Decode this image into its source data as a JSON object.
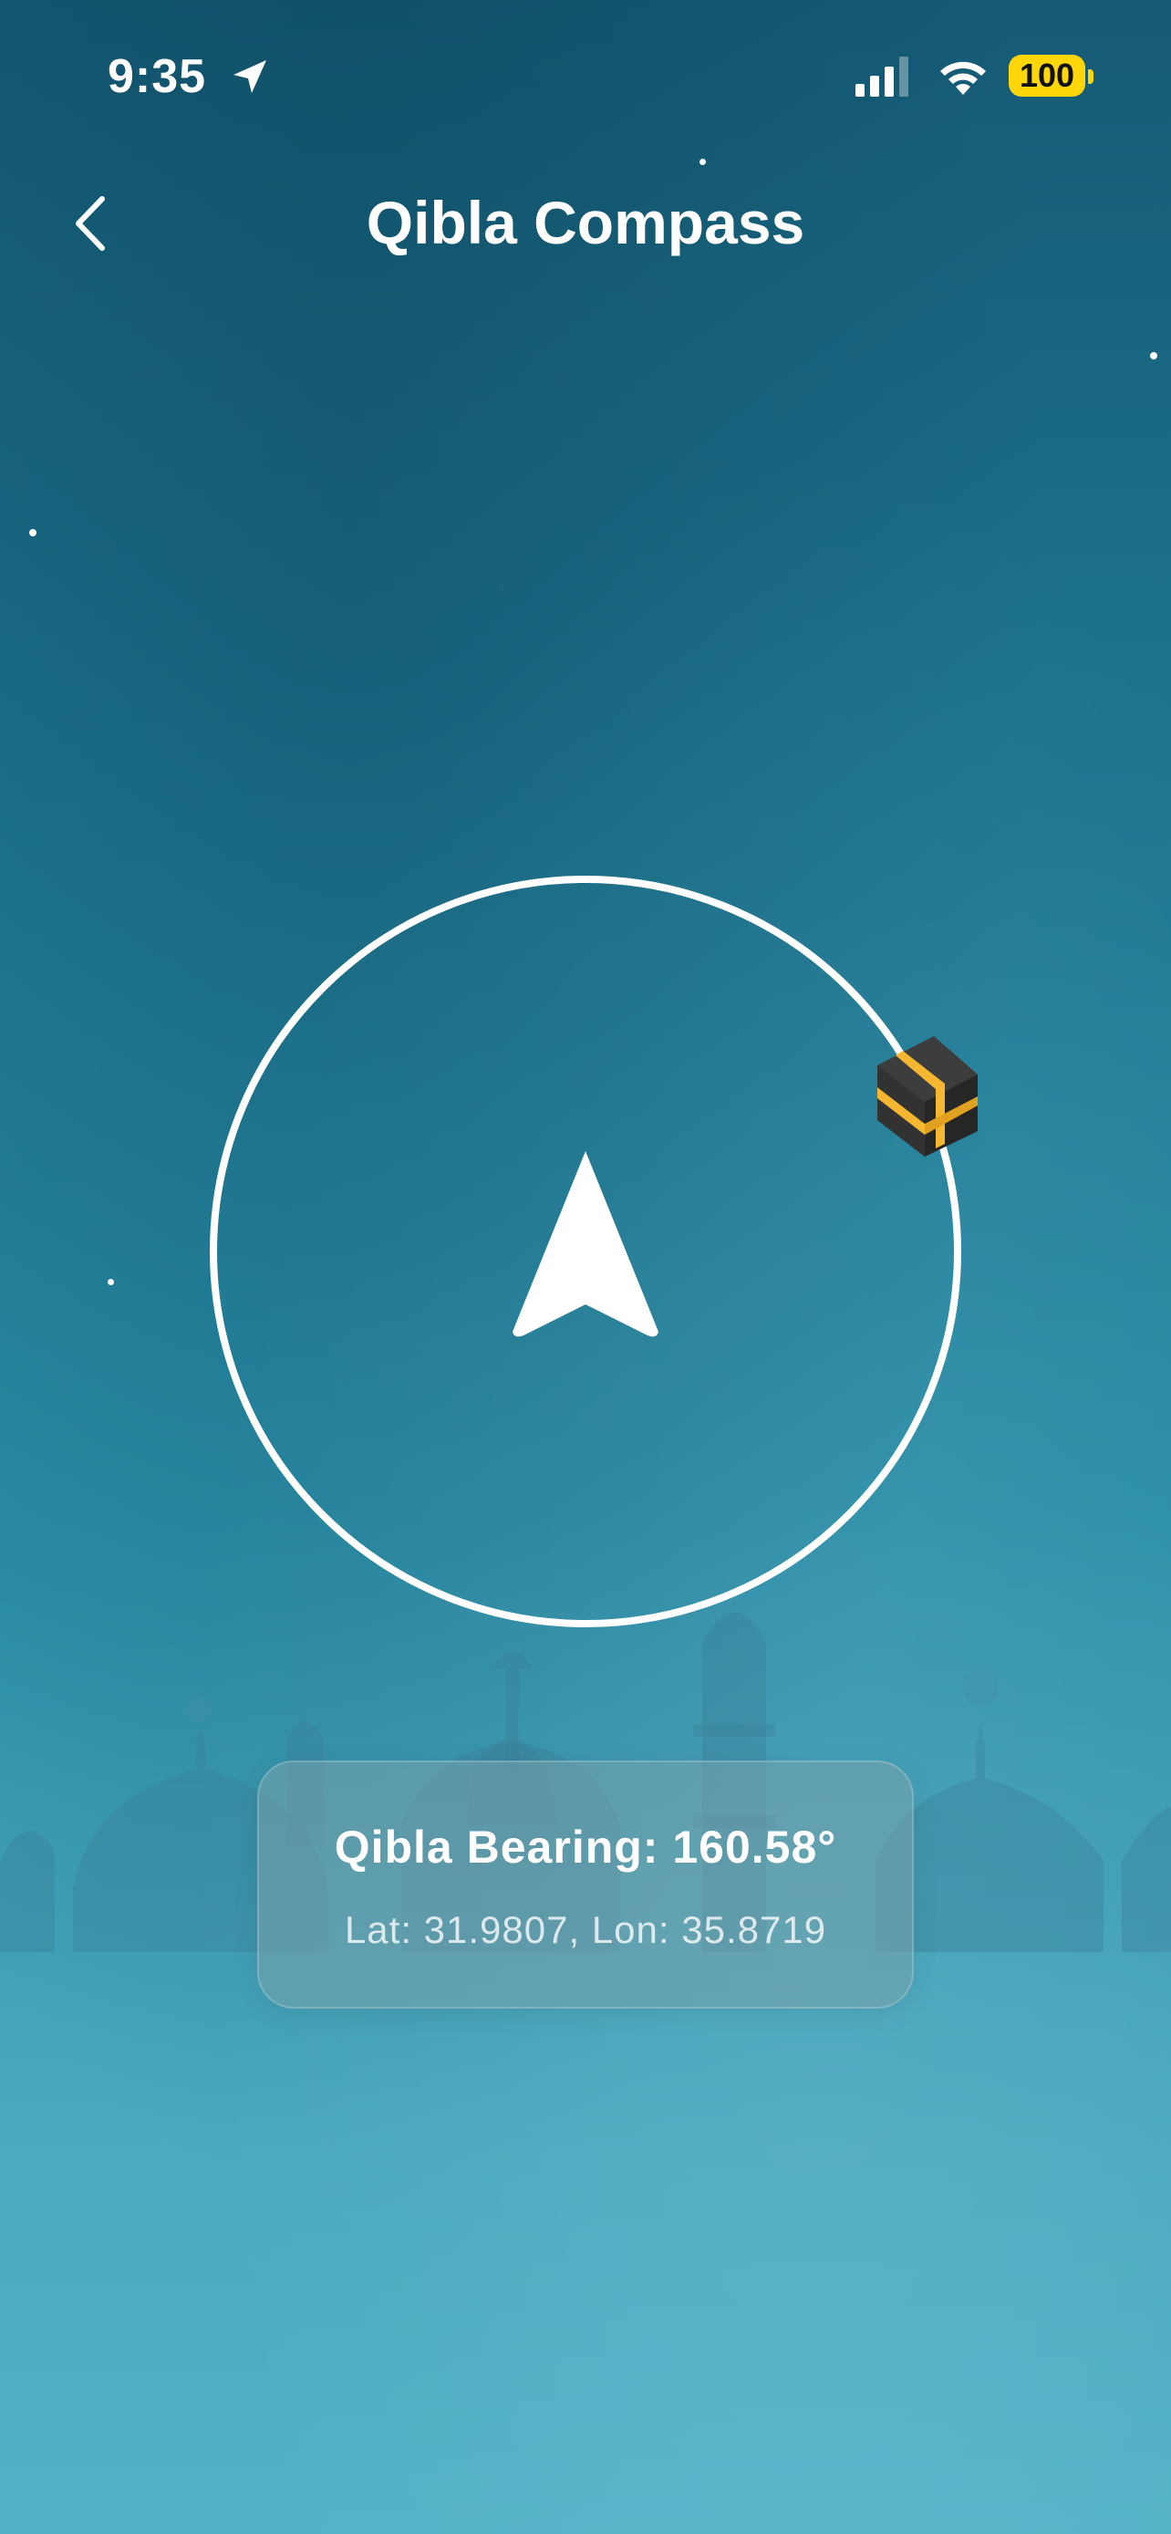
{
  "status_bar": {
    "time": "9:35",
    "battery_level": "100",
    "icons": [
      "location-arrow-icon",
      "cellular-signal-icon",
      "wifi-icon",
      "battery-icon"
    ],
    "battery_color": "#ffd60a"
  },
  "nav": {
    "back_icon": "chevron-left-icon",
    "title": "Qibla Compass"
  },
  "compass": {
    "direction_icon": "navigation-arrow-icon",
    "kaaba_icon": "kaaba-icon"
  },
  "info": {
    "bearing": "Qibla Bearing: 160.58°",
    "coordinates": "Lat: 31.9807, Lon: 35.8719"
  },
  "colors": {
    "background_top": "#155a74",
    "background_bottom": "#52b2c6",
    "accent": "#ffffff",
    "kaaba_band": "#f5b731"
  }
}
